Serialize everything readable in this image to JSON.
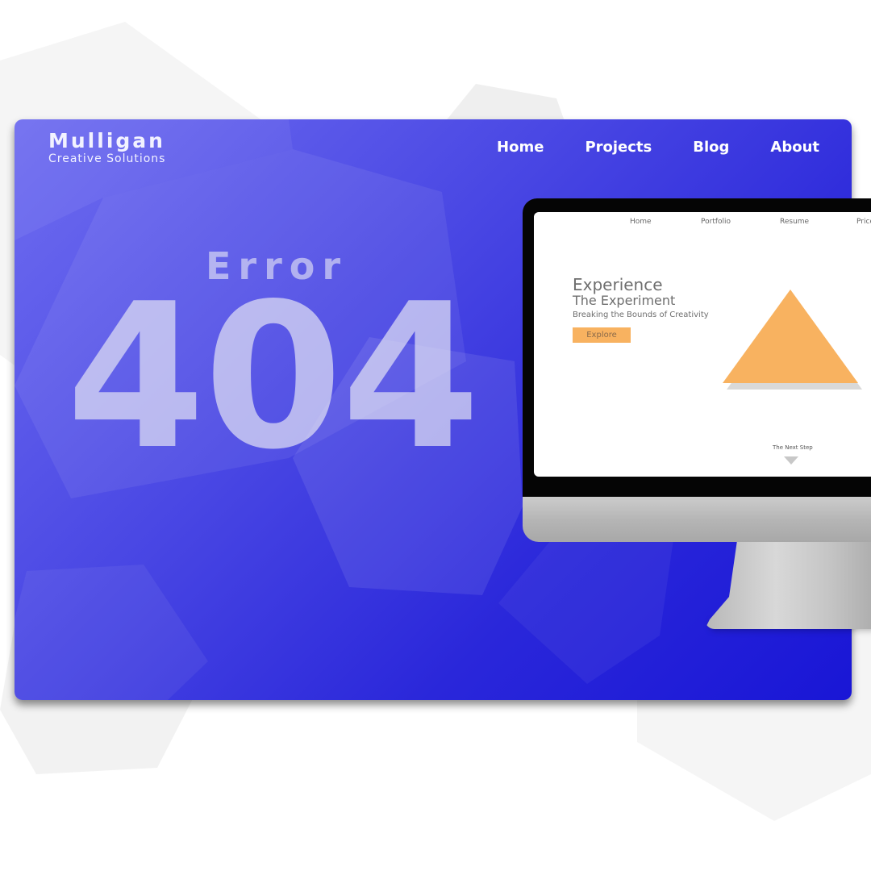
{
  "brand": {
    "name": "Mulligan",
    "tagline": "Creative Solutions"
  },
  "nav": {
    "items": [
      "Home",
      "Projects",
      "Blog",
      "About"
    ]
  },
  "error": {
    "label": "Error",
    "code": "404"
  },
  "mockup": {
    "nav": [
      "Home",
      "Portfolio",
      "Resume",
      "Price"
    ],
    "title": "Experience",
    "subtitle": "The Experiment",
    "tagline": "Breaking the Bounds of Creativity",
    "button": "Explore",
    "next_step": "The Next Step"
  },
  "colors": {
    "accent": "#f8b260",
    "gradient_start": "#6f6df0",
    "gradient_end": "#1916d6"
  }
}
